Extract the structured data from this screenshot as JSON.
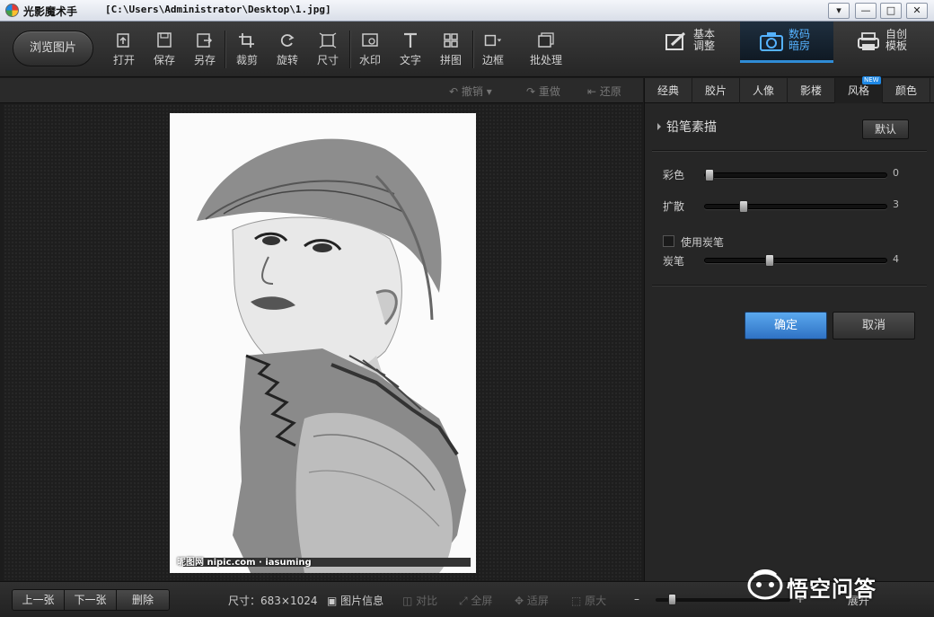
{
  "window": {
    "app_name": "光影魔术手",
    "file_path": "[C:\\Users\\Administrator\\Desktop\\1.jpg]",
    "controls": [
      "▾",
      "—",
      "□",
      "✕"
    ]
  },
  "toolbar": {
    "browse_label": "浏览图片",
    "tools": [
      {
        "label": "打开",
        "icon": "open-icon"
      },
      {
        "label": "保存",
        "icon": "save-icon"
      },
      {
        "label": "另存",
        "icon": "save-as-icon"
      },
      {
        "label": "裁剪",
        "icon": "crop-icon"
      },
      {
        "label": "旋转",
        "icon": "rotate-icon"
      },
      {
        "label": "尺寸",
        "icon": "resize-icon"
      },
      {
        "label": "水印",
        "icon": "watermark-icon"
      },
      {
        "label": "文字",
        "icon": "text-icon"
      },
      {
        "label": "拼图",
        "icon": "collage-icon"
      },
      {
        "label": "边框",
        "icon": "border-icon"
      },
      {
        "label": "批处理",
        "icon": "batch-icon"
      }
    ],
    "modes": [
      {
        "label_line1": "基本",
        "label_line2": "调整",
        "icon": "basic-adjust-icon"
      },
      {
        "label_line1": "数码",
        "label_line2": "暗房",
        "icon": "camera-icon"
      },
      {
        "label_line1": "自创",
        "label_line2": "模板",
        "icon": "template-icon"
      }
    ]
  },
  "history": {
    "undo": "撤销",
    "redo": "重做",
    "restore": "还原"
  },
  "photo": {
    "watermark": "昵图网 nipic.com · iasuming"
  },
  "panel": {
    "tabs": [
      "经典",
      "胶片",
      "人像",
      "影楼",
      "风格",
      "颜色"
    ],
    "active_tab": "风格",
    "new_badge": "NEW",
    "effect_name": "铅笔素描",
    "default_button": "默认",
    "sliders": [
      {
        "label": "彩色",
        "value": "0",
        "fraction": 0.0
      },
      {
        "label": "扩散",
        "value": "3",
        "fraction": 0.2
      },
      {
        "label": "炭笔",
        "value": "4",
        "fraction": 0.35
      }
    ],
    "use_charcoal": "使用炭笔",
    "ok": "确定",
    "cancel": "取消"
  },
  "bottombar": {
    "prev": "上一张",
    "next": "下一张",
    "delete": "删除",
    "size_label": "尺寸：683×1024",
    "image_info": "图片信息",
    "compare": "对比",
    "fullscreen": "全屏",
    "fit": "适屏",
    "original": "原大",
    "zoom_minus": "–",
    "zoom_plus": "+",
    "expand": "展开",
    "zoom_fraction": 0.1
  },
  "overlay_logo": "悟空问答",
  "colors": {
    "accent": "#2f8cd6",
    "ok_button": "#3f88d6"
  }
}
